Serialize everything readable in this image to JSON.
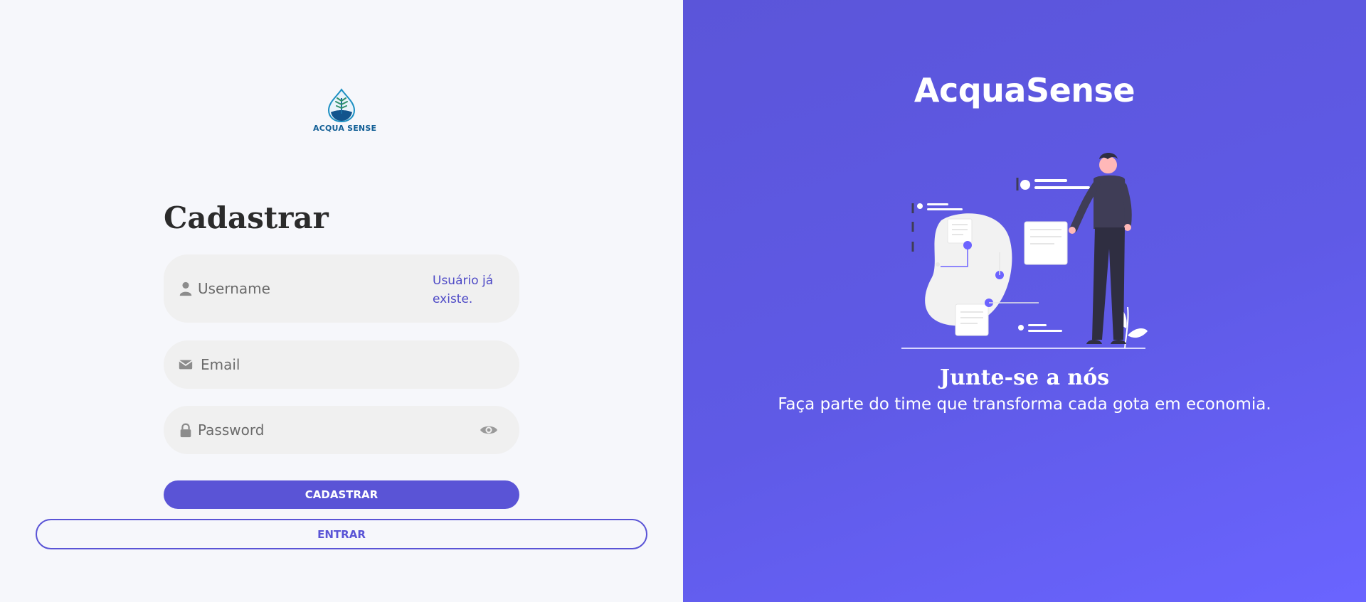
{
  "logo": {
    "text": "ACQUA SENSE"
  },
  "form": {
    "title": "Cadastrar",
    "username": {
      "placeholder": "Username",
      "error": "Usuário já existe."
    },
    "email": {
      "placeholder": "Email"
    },
    "password": {
      "placeholder": "Password"
    },
    "submit_label": "CADASTRAR",
    "login_label": "ENTRAR"
  },
  "promo": {
    "brand": "AcquaSense",
    "title": "Junte-se a nós",
    "subtitle": "Faça parte do time que transforma cada gota em economia."
  },
  "colors": {
    "accent": "#5a54d6",
    "panel_gradient_start": "#5b55d9",
    "panel_gradient_end": "#6a64ff",
    "left_background": "#f6f7fb",
    "field_background": "#f0f0f0"
  },
  "icons": {
    "username": "user-icon",
    "email": "envelope-icon",
    "password": "lock-icon",
    "toggle": "eye-icon"
  }
}
